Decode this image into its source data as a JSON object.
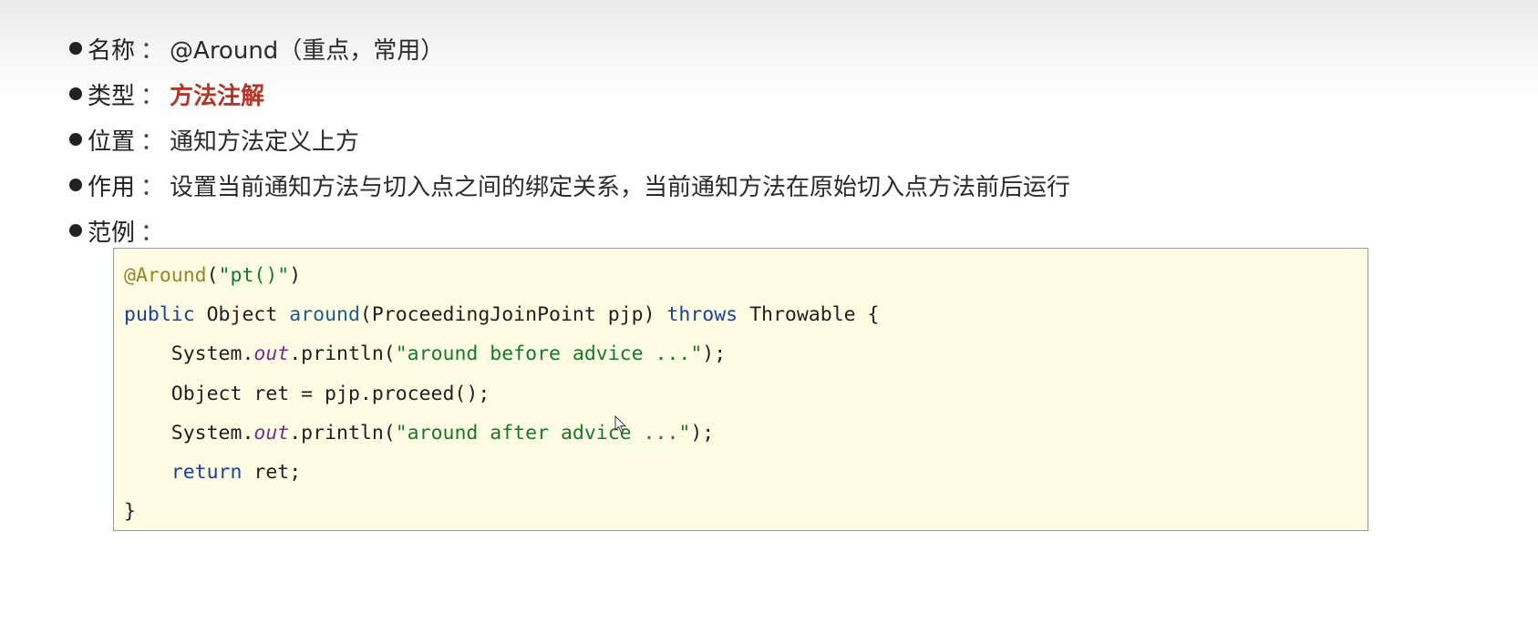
{
  "list": {
    "items": [
      {
        "label": "名称",
        "sep": "：",
        "value": "@Around（重点，常用）",
        "emphasis": false
      },
      {
        "label": "类型",
        "sep": "：",
        "value": "方法注解",
        "emphasis": true
      },
      {
        "label": "位置",
        "sep": "：",
        "value": "通知方法定义上方",
        "emphasis": false
      },
      {
        "label": "作用",
        "sep": "：",
        "value": "设置当前通知方法与切入点之间的绑定关系，当前通知方法在原始切入点方法前后运行",
        "emphasis": false
      },
      {
        "label": "范例",
        "sep": "：",
        "value": "",
        "emphasis": false
      }
    ]
  },
  "code": {
    "lines": [
      [
        {
          "t": "@Around",
          "c": "annot"
        },
        {
          "t": "(",
          "c": "plain"
        },
        {
          "t": "\"pt()\"",
          "c": "str"
        },
        {
          "t": ")",
          "c": "plain"
        }
      ],
      [
        {
          "t": "public",
          "c": "kw"
        },
        {
          "t": " Object ",
          "c": "plain"
        },
        {
          "t": "around",
          "c": "fn"
        },
        {
          "t": "(ProceedingJoinPoint pjp) ",
          "c": "plain"
        },
        {
          "t": "throws",
          "c": "kw"
        },
        {
          "t": " Throwable {",
          "c": "plain"
        }
      ],
      [
        {
          "t": "    System.",
          "c": "plain"
        },
        {
          "t": "out",
          "c": "static"
        },
        {
          "t": ".println(",
          "c": "plain"
        },
        {
          "t": "\"around before advice ...\"",
          "c": "str"
        },
        {
          "t": ");",
          "c": "plain"
        }
      ],
      [
        {
          "t": "    Object ret = pjp.proceed();",
          "c": "plain"
        }
      ],
      [
        {
          "t": "    System.",
          "c": "plain"
        },
        {
          "t": "out",
          "c": "static"
        },
        {
          "t": ".println(",
          "c": "plain"
        },
        {
          "t": "\"around after advice ...\"",
          "c": "str"
        },
        {
          "t": ");",
          "c": "plain"
        }
      ],
      [
        {
          "t": "    ",
          "c": "plain"
        },
        {
          "t": "return",
          "c": "kw"
        },
        {
          "t": " ret;",
          "c": "plain"
        }
      ],
      [
        {
          "t": "}",
          "c": "plain"
        }
      ]
    ]
  },
  "colors": {
    "emphasis": "#b5352a",
    "code_background": "#fefde3",
    "annotation": "#9b8425",
    "string": "#157a2c",
    "keyword": "#1c3f9c",
    "method": "#1d5f8a",
    "static_field": "#7a2c8e"
  },
  "icons": {
    "cursor": "mouse-pointer-icon"
  }
}
